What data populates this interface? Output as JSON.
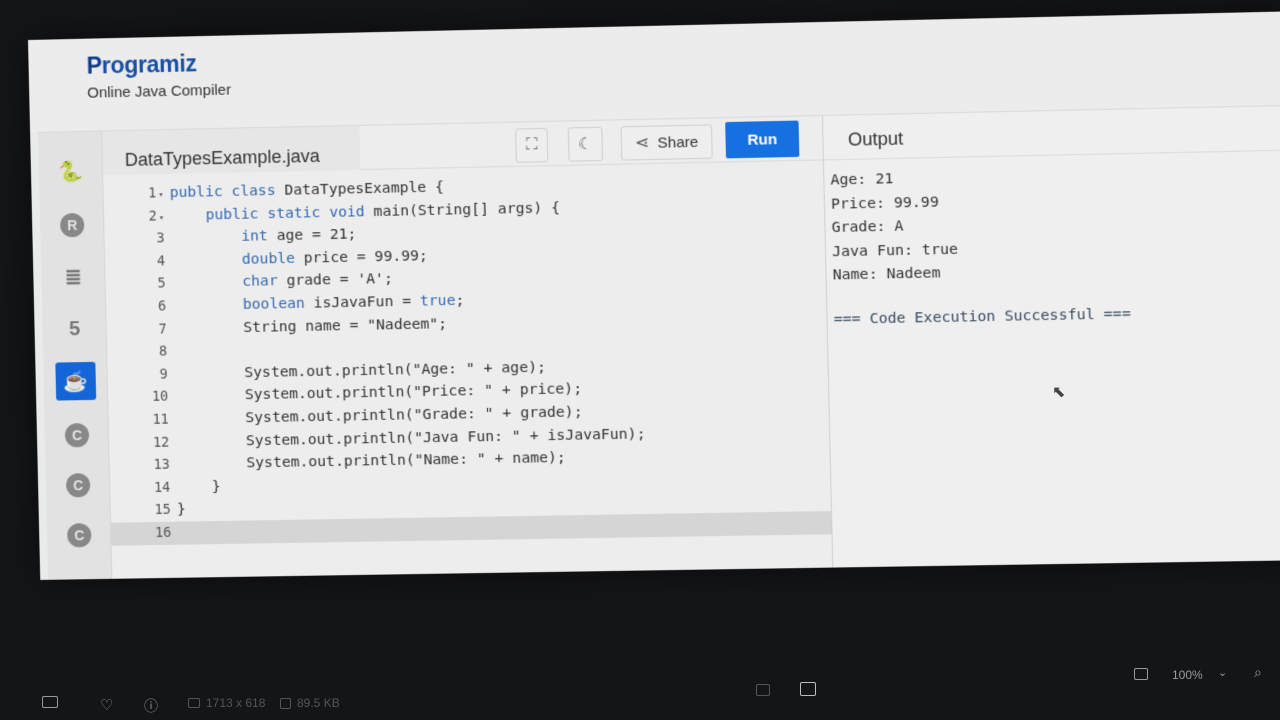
{
  "site": {
    "brand_first": "P",
    "brand_rest": "rogramiz",
    "subtitle": "Online Java Compiler"
  },
  "language_bar": [
    {
      "icon": "python-icon",
      "glyph": "🐍"
    },
    {
      "icon": "r-icon",
      "glyph": "R"
    },
    {
      "icon": "sql-icon",
      "glyph": "≣"
    },
    {
      "icon": "html5-icon",
      "glyph": "5"
    },
    {
      "icon": "java-icon",
      "glyph": "☕",
      "active": true
    },
    {
      "icon": "c-icon",
      "glyph": "C"
    },
    {
      "icon": "cpp-icon",
      "glyph": "C"
    },
    {
      "icon": "csharp-icon",
      "glyph": "C"
    }
  ],
  "editor": {
    "filename": "DataTypesExample.java",
    "fullscreen_glyph": "⛶",
    "theme_glyph": "☾",
    "share_glyph": "⋖",
    "share_label": "Share",
    "run_label": "Run"
  },
  "code_lines": [
    {
      "n": "1",
      "fold": true,
      "html": "<span class=\"kw\">public class</span> DataTypesExample {"
    },
    {
      "n": "2",
      "fold": true,
      "html": "    <span class=\"kw\">public static void</span> main(String[] args) {"
    },
    {
      "n": "3",
      "html": "        <span class=\"ty\">int</span> age = 21;"
    },
    {
      "n": "4",
      "html": "        <span class=\"ty\">double</span> price = 99.99;"
    },
    {
      "n": "5",
      "html": "        <span class=\"ty\">char</span> grade = 'A';"
    },
    {
      "n": "6",
      "html": "        <span class=\"ty\">boolean</span> isJavaFun = <span class=\"kw\">true</span>;"
    },
    {
      "n": "7",
      "html": "        String name = \"Nadeem\";"
    },
    {
      "n": "8",
      "html": ""
    },
    {
      "n": "9",
      "html": "        System.out.println(\"Age: \" + age);"
    },
    {
      "n": "10",
      "html": "        System.out.println(\"Price: \" + price);"
    },
    {
      "n": "11",
      "html": "        System.out.println(\"Grade: \" + grade);"
    },
    {
      "n": "12",
      "html": "        System.out.println(\"Java Fun: \" + isJavaFun);"
    },
    {
      "n": "13",
      "html": "        System.out.println(\"Name: \" + name);"
    },
    {
      "n": "14",
      "html": "    }"
    },
    {
      "n": "15",
      "html": "}"
    },
    {
      "n": "16",
      "html": "",
      "current": true
    }
  ],
  "output": {
    "title": "Output",
    "lines": [
      "Age: 21",
      "Price: 99.99",
      "Grade: A",
      "Java Fun: true",
      "Name: Nadeem"
    ],
    "status": "=== Code Execution Successful ==="
  },
  "viewer": {
    "dimensions": "1713 x 618",
    "file_size": "89.5 KB",
    "zoom": "100%"
  }
}
